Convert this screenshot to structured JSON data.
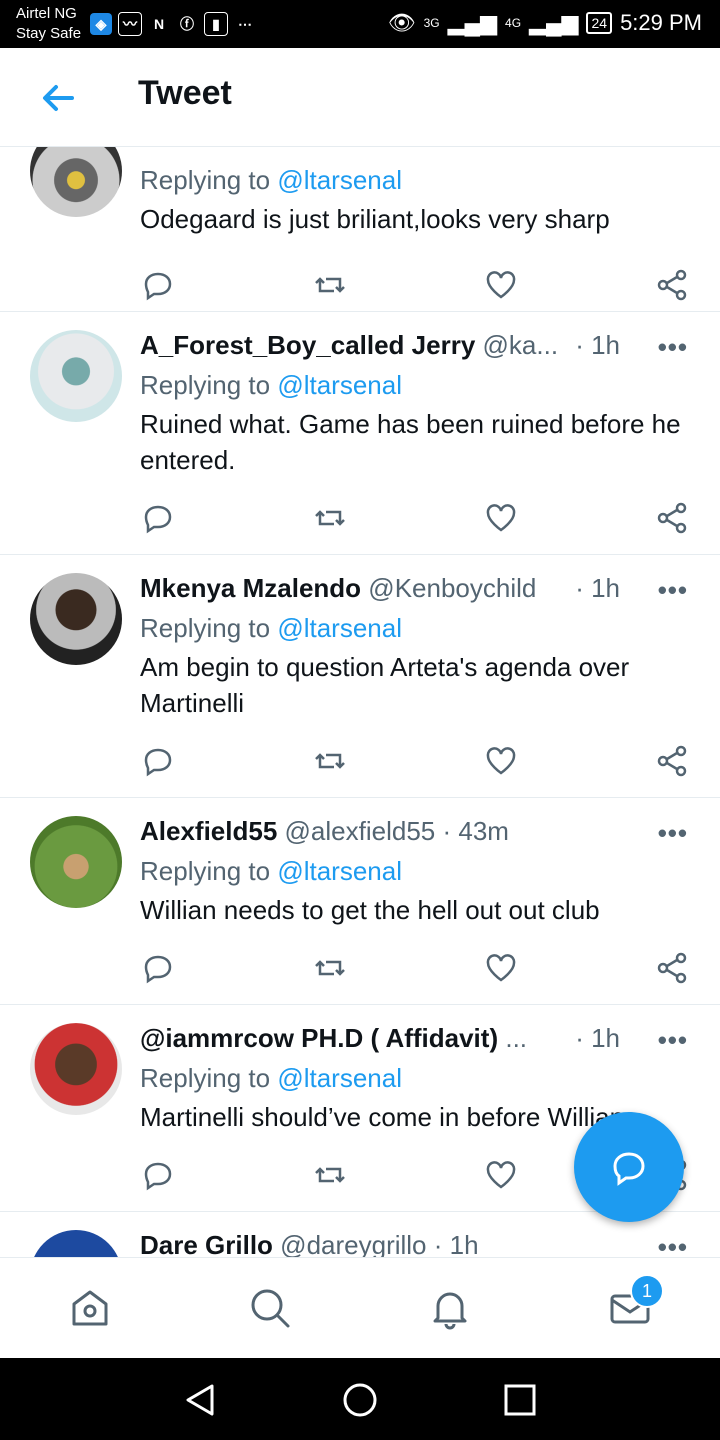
{
  "status_bar": {
    "carrier": "Airtel NG",
    "carrier_sub": "Stay Safe",
    "network_1": "3G",
    "network_2": "4G",
    "battery": "24",
    "time": "5:29 PM"
  },
  "header": {
    "title": "Tweet"
  },
  "tweets": [
    {
      "replying_prefix": "Replying to",
      "mention": "@ltarsenal",
      "text": "Odegaard is just briliant,looks very sharp"
    },
    {
      "name": "A_Forest_Boy_called Jerry",
      "handle": "@ka...",
      "time": "· 1h",
      "replying_prefix": "Replying to",
      "mention": "@ltarsenal",
      "text": "Ruined what. Game has been ruined before he entered."
    },
    {
      "name": "Mkenya Mzalendo",
      "handle": "@Kenboychild",
      "time": "· 1h",
      "replying_prefix": "Replying to",
      "mention": "@ltarsenal",
      "text": "Am begin to question Arteta's agenda over Martinelli"
    },
    {
      "name": "Alexfield55",
      "handle": "@alexfield55",
      "time": "· 43m",
      "replying_prefix": "Replying to",
      "mention": "@ltarsenal",
      "text": "Willian needs to get the hell out out club"
    },
    {
      "name": "@iammrcow PH.D ( Affidavit)",
      "handle": "...",
      "time": "· 1h",
      "replying_prefix": "Replying to",
      "mention": "@ltarsenal",
      "text": "Martinelli should’ve come in before Willians"
    },
    {
      "name": "Dare Grillo",
      "handle": "@dareygrillo",
      "time": "· 1h"
    }
  ],
  "more_label": "•••",
  "bottom_nav": {
    "messages_badge": "1"
  },
  "colors": {
    "accent": "#1d9bf0",
    "secondary_text": "#536471"
  }
}
